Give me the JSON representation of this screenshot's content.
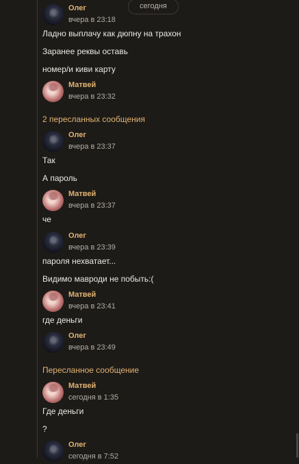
{
  "date_divider": "сегодня",
  "blocks": {
    "b1": {
      "author": "Олег",
      "time": "вчера в 23:18",
      "messages": [
        "Ладно выплачу как дюпну на трахон",
        "Заранее реквы оставь",
        "номер/и киви карту"
      ]
    },
    "b2": {
      "author": "Матвей",
      "time": "вчера в 23:32"
    },
    "fwd1": "2 пересланных сообщения",
    "b3": {
      "author": "Олег",
      "time": "вчера в 23:37",
      "messages": [
        "Так",
        "А пароль"
      ]
    },
    "b4": {
      "author": "Матвей",
      "time": "вчера в 23:37",
      "messages": [
        "че"
      ]
    },
    "b5": {
      "author": "Олег",
      "time": "вчера в 23:39",
      "messages": [
        "пароля нехватает...",
        "Видимо мавроди не побыть:("
      ]
    },
    "b6": {
      "author": "Матвей",
      "time": "вчера в 23:41",
      "messages": [
        "где деньги"
      ]
    },
    "b7": {
      "author": "Олег",
      "time": "вчера в 23:49"
    },
    "fwd2": "Пересланное сообщение",
    "b8": {
      "author": "Матвей",
      "time": "сегодня в 1:35",
      "messages": [
        "Где деньги",
        "?"
      ]
    },
    "b9": {
      "author": "Олег",
      "time": "сегодня в 7:52"
    }
  },
  "colors": {
    "background": "#1d1b18",
    "author": "#e2b472",
    "text": "#ece9e4",
    "muted": "#b2aea7"
  }
}
